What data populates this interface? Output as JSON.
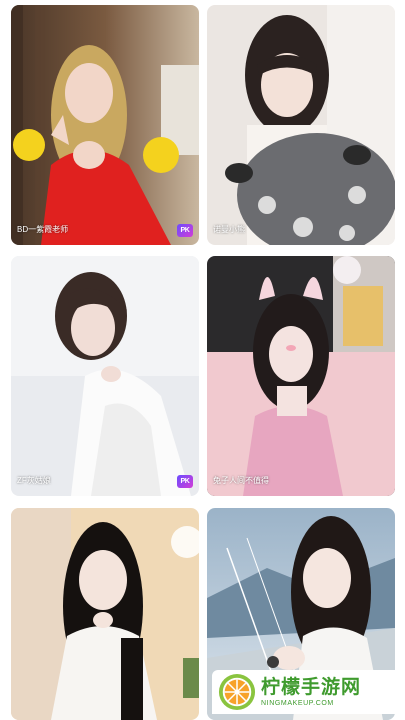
{
  "cards": [
    {
      "caption": "BD一紫霞老师",
      "badge": "PK"
    },
    {
      "caption": "诺曼小熊",
      "badge": ""
    },
    {
      "caption": "ZF灰姑娘",
      "badge": "PK"
    },
    {
      "caption": "兔子人间不值得",
      "badge": ""
    },
    {
      "caption": "",
      "badge": ""
    },
    {
      "caption": "",
      "badge": ""
    }
  ],
  "watermark": {
    "title": "柠檬手游网",
    "subtitle": "NINGMAKEUP.COM"
  },
  "colors": {
    "badge_start": "#6c4cff",
    "badge_end": "#d23dd6",
    "watermark_green": "#3f9b2e"
  }
}
